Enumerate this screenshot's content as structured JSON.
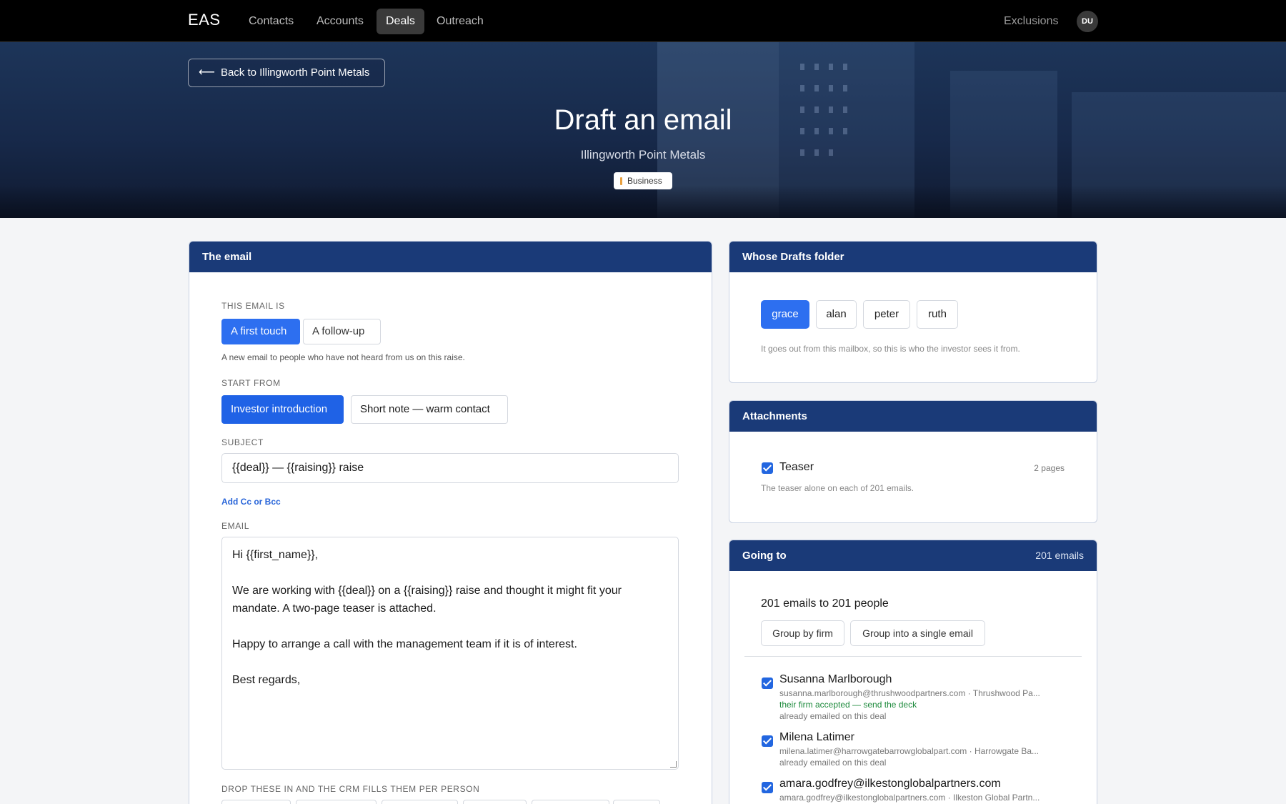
{
  "nav": {
    "brand": "EAS",
    "links": [
      "Contacts",
      "Accounts",
      "Deals",
      "Outreach"
    ],
    "active": "Deals",
    "exclusions": "Exclusions",
    "avatar": "DU"
  },
  "hero": {
    "back_arrow": "⟵",
    "back_label": "Back to Illingworth Point Metals",
    "title": "Draft an email",
    "subtitle": "Illingworth Point Metals",
    "badge": "Business"
  },
  "email_panel": {
    "header": "The email",
    "type_label": "THIS EMAIL IS",
    "type_options": [
      "A first touch",
      "A follow-up"
    ],
    "type_selected": "A first touch",
    "type_hint": "A new email to people who have not heard from us on this raise.",
    "start_label": "START FROM",
    "start_options": [
      "Investor introduction",
      "Short note — warm contact"
    ],
    "start_selected": "Investor introduction",
    "subject_label": "SUBJECT",
    "subject_value": "{{deal}} — {{raising}} raise",
    "cc_link": "Add Cc or Bcc",
    "body_label": "EMAIL",
    "body_lines": [
      "Hi {{first_name}},",
      "",
      "We are working with {{deal}} on a {{raising}} raise and thought it might fit your",
      "mandate. A two-page teaser is attached.",
      "",
      "Happy to arrange a call with the management team if it is of interest.",
      "",
      "Best regards,"
    ],
    "merge_label": "DROP THESE IN AND THE CRM FILLS THEM PER PERSON"
  },
  "drafts_panel": {
    "header": "Whose Drafts folder",
    "mailboxes": [
      "grace",
      "alan",
      "peter",
      "ruth"
    ],
    "selected": "grace",
    "hint": "It goes out from this mailbox, so this is who the investor sees it from."
  },
  "attachments_panel": {
    "header": "Attachments",
    "item_name": "Teaser",
    "item_checked": true,
    "item_pages": "2 pages",
    "hint": "The teaser alone on each of 201 emails."
  },
  "going_to_panel": {
    "header": "Going to",
    "header_count": "201 emails",
    "summary": "201 emails to 201 people",
    "group_buttons": [
      "Group by firm",
      "Group into a single email"
    ],
    "recipients": [
      {
        "name": "Susanna Marlborough",
        "detail": "susanna.marlborough@thrushwoodpartners.com · Thrushwood Pa...",
        "status": "their firm accepted — send the deck",
        "note": "already emailed on this deal",
        "checked": true
      },
      {
        "name": "Milena Latimer",
        "detail": "milena.latimer@harrowgatebarrowglobalpart.com · Harrowgate Ba...",
        "status": "",
        "note": "already emailed on this deal",
        "checked": true
      },
      {
        "name": "amara.godfrey@ilkestonglobalpartners.com",
        "detail": "amara.godfrey@ilkestonglobalpartners.com · Ilkeston Global Partn...",
        "status": "",
        "note": "",
        "checked": true
      }
    ]
  },
  "colors": {
    "nav_bg": "#000000",
    "panel_header": "#1a3a78",
    "accent": "#2d6ff0",
    "success_text": "#1d8a3c"
  }
}
